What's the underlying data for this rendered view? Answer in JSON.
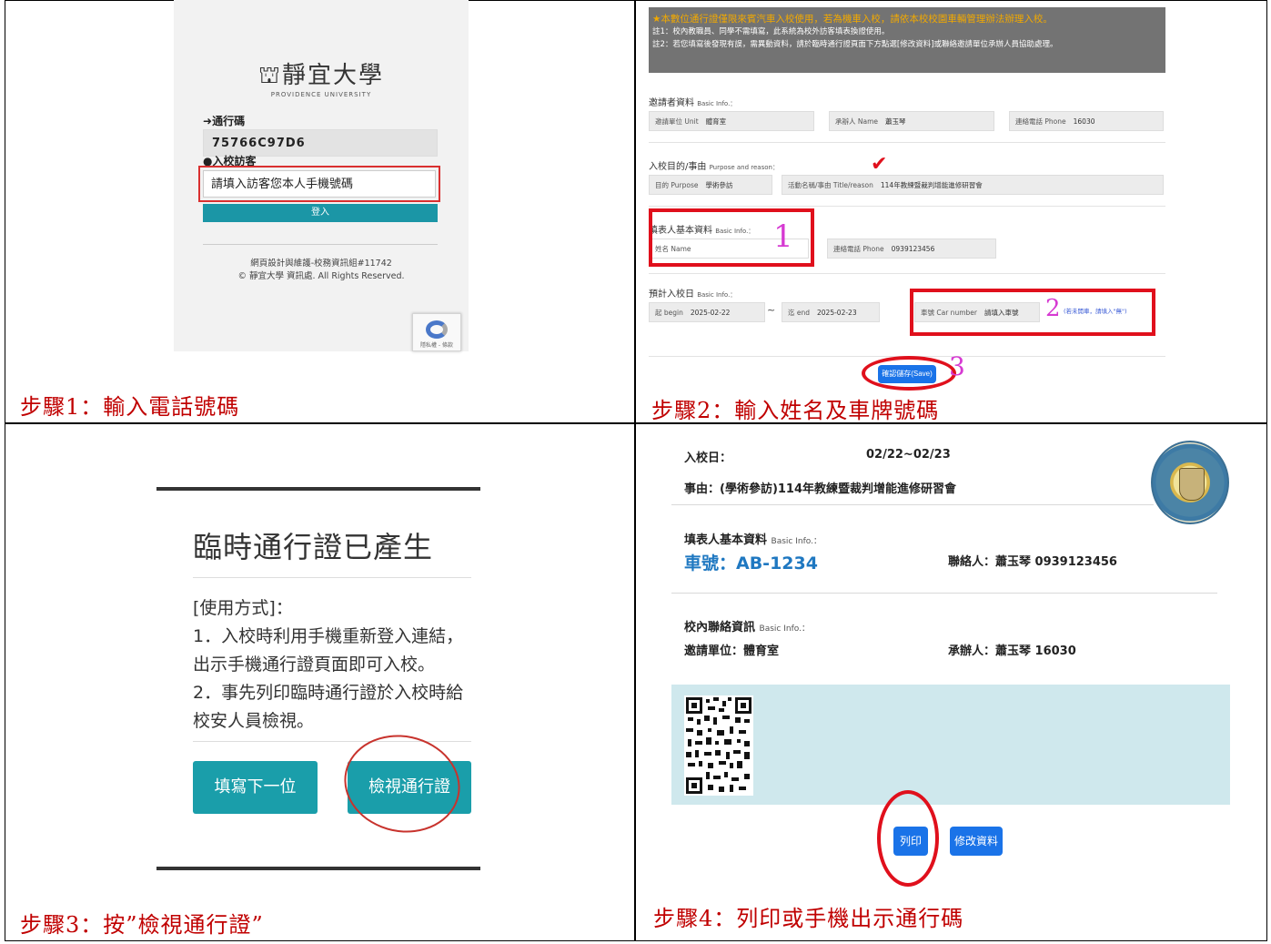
{
  "captions": {
    "step1": "步驟1：輸入電話號碼",
    "step2": "步驟2：輸入姓名及車牌號碼",
    "step3": "步驟3：按”檢視通行證”",
    "step4": "步驟4：列印或手機出示通行碼"
  },
  "login": {
    "logo_text": "靜宜大學",
    "logo_subtitle": "PROVIDENCE UNIVERSITY",
    "pass_code_label": "通行碼",
    "pass_code_value": "75766C97D6",
    "visitor_label": "入校訪客",
    "phone_placeholder": "請填入訪客您本人手機號碼",
    "login_button": "登入",
    "footer_line1": "網頁設計與維護-校務資訊組#11742",
    "footer_line2": "© 靜宜大學 資訊處. All Rights Reserved.",
    "captcha_text": "隱私權 - 條款"
  },
  "form": {
    "notice_main": "★本數位通行證僅限來賓汽車入校使用，若為機車入校，請依本校校園車輛管理辦法辦理入校。",
    "notice_1": "註1：校內教職員、同學不需填寫，此系統為校外訪客填表換證使用。",
    "notice_2": "註2：若您填寫後發現有誤，需異動資料，請於臨時通行證頁面下方點選[修改資料]或聯絡邀請單位承辦人員協助處理。",
    "inviter_title": "邀請者資料",
    "inviter_title_en": "Basic Info.：",
    "unit_label": "邀請單位 Unit",
    "unit_value": "體育室",
    "contact_label": "承辦人 Name",
    "contact_value": "蕭玉琴",
    "phone_label": "連絡電話 Phone",
    "phone_value": "16030",
    "purpose_title": "入校目的/事由",
    "purpose_title_en": "Purpose and reason：",
    "purpose_label": "目的 Purpose",
    "purpose_value": "學術參訪",
    "event_label": "活動名稱/事由 Title/reason",
    "event_value": "114年教練暨裁判增能進修研習會",
    "filler_title": "填表人基本資料",
    "filler_title_en": "Basic Info.：",
    "name_label": "姓名 Name",
    "filler_phone_label": "連絡電話 Phone",
    "filler_phone_value": "0939123456",
    "date_title": "預計入校日",
    "date_title_en": "Basic Info.：",
    "begin_label": "起 begin",
    "begin_value": "2025-02-22",
    "tilde": "~",
    "end_label": "迄 end",
    "end_value": "2025-02-23",
    "car_label": "車號 Car number",
    "car_placeholder": "請填入車號",
    "car_hint": "(若未開車，請填入\"無\")",
    "save_button": "確認儲存(Save)",
    "mark1": "1",
    "mark2": "2",
    "mark3": "3"
  },
  "dialog": {
    "title": "臨時通行證已產生",
    "usage_title": "[使用方式]：",
    "usage_1": "1．入校時利用手機重新登入連結，出示手機通行證頁面即可入校。",
    "usage_2": "2．事先列印臨時通行證於入校時給校安人員檢視。",
    "next_button": "填寫下一位",
    "view_button": "檢視通行證"
  },
  "pass": {
    "date_label": "入校日：",
    "date_value": "02/22~02/23",
    "reason": "事由：(學術參訪)114年教練暨裁判增能進修研習會",
    "filler_title": "填表人基本資料",
    "filler_title_en": "Basic Info.：",
    "car": "車號：AB-1234",
    "contact": "聯絡人：蕭玉琴 0939123456",
    "campus_title": "校內聯絡資訊",
    "campus_title_en": "Basic Info.：",
    "inviter": "邀請單位：體育室",
    "handler": "承辦人：蕭玉琴 16030",
    "print_button": "列印",
    "edit_button": "修改資料"
  }
}
